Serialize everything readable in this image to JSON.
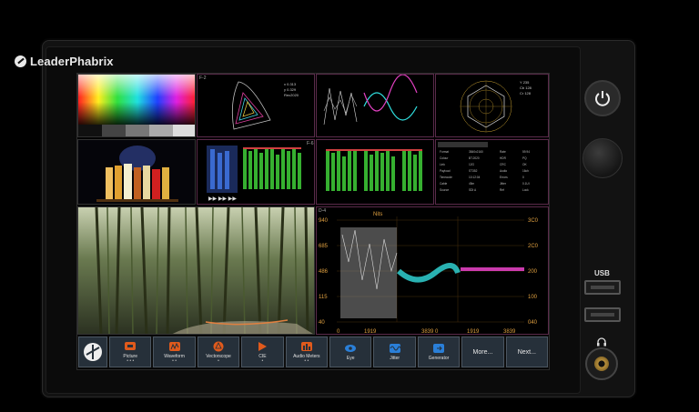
{
  "brand": {
    "logo_text": "LeaderPhabrix"
  },
  "panes": {
    "vectorscope_label": "F-2",
    "waveform_label": "F-3",
    "eye_label": "F-4",
    "meters_label": "F-6",
    "main_label": "D-4",
    "main_axis_left": [
      "940",
      "685",
      "486",
      "115",
      "40"
    ],
    "main_axis_right": [
      "3C0",
      "2C0",
      "200",
      "100",
      "040"
    ],
    "main_axis_bottom": [
      "0",
      "1919",
      "3839 0",
      "1919",
      "3839"
    ],
    "main_axis_top": "Nits"
  },
  "toolbar": {
    "buttons": [
      {
        "label": "Picture",
        "dots": "• • •",
        "icon": "picture-icon",
        "color": "#e05a1c"
      },
      {
        "label": "Waveform",
        "dots": "• •",
        "icon": "waveform-icon",
        "color": "#e05a1c"
      },
      {
        "label": "Vectorscope",
        "dots": "•",
        "icon": "vectorscope-icon",
        "color": "#e05a1c"
      },
      {
        "label": "CIE",
        "dots": "•",
        "icon": "cie-icon",
        "color": "#e05a1c"
      },
      {
        "label": "Audio Meters",
        "dots": "• •",
        "icon": "audio-meters-icon",
        "color": "#e05a1c"
      },
      {
        "label": "Eye",
        "dots": "",
        "icon": "eye-icon",
        "color": "#2a7fd8"
      },
      {
        "label": "Jitter",
        "dots": "",
        "icon": "jitter-icon",
        "color": "#2a7fd8"
      },
      {
        "label": "Generator",
        "dots": "",
        "icon": "generator-icon",
        "color": "#2a7fd8"
      },
      {
        "label": "More...",
        "dots": "",
        "icon": "",
        "color": ""
      },
      {
        "label": "Next...",
        "dots": "",
        "icon": "",
        "color": ""
      }
    ]
  },
  "hardware": {
    "usb_label": "USB"
  }
}
